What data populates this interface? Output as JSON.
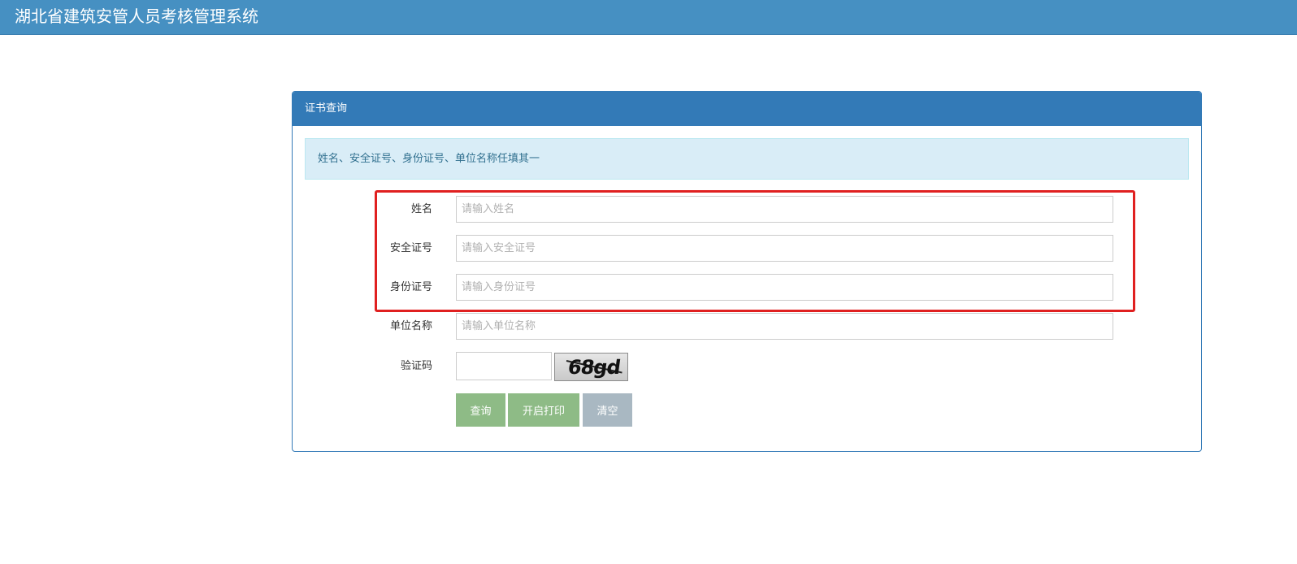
{
  "header": {
    "app_title": "湖北省建筑安管人员考核管理系统",
    "bg_color": "#4690c2"
  },
  "panel": {
    "title": "证书查询",
    "heading_color": "#337ab7",
    "notice": "姓名、安全证号、身份证号、单位名称任填其一"
  },
  "form": {
    "fields": [
      {
        "label": "姓名",
        "value": "",
        "placeholder": "请输入姓名"
      },
      {
        "label": "安全证号",
        "value": "",
        "placeholder": "请输入安全证号"
      },
      {
        "label": "身份证号",
        "value": "",
        "placeholder": "请输入身份证号"
      },
      {
        "label": "单位名称",
        "value": "",
        "placeholder": "请输入单位名称"
      }
    ],
    "captcha": {
      "label": "验证码",
      "value": "",
      "image_text": "68gd"
    },
    "buttons": {
      "query": "查询",
      "print": "开启打印",
      "clear": "清空"
    }
  },
  "colors": {
    "button_green": "#8ebb86",
    "button_gray": "#a9b8c2",
    "highlight_red": "#e02020",
    "notice_bg": "#d9edf7",
    "notice_text": "#31708f"
  }
}
